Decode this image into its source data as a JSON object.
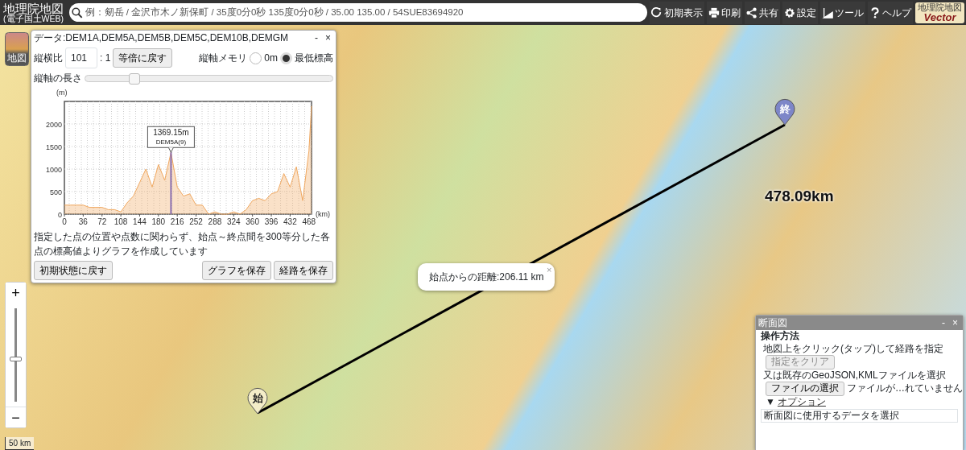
{
  "header": {
    "logo_lines": [
      "地理院地図",
      "(電子国土WEB)"
    ],
    "search": {
      "placeholder": "例：剱岳 / 金沢市木ノ新保町 / 35度0分0秒 135度0分0秒 / 35.00 135.00 / 54SUE83694920"
    },
    "toolbar": [
      {
        "kind": "reload",
        "label": "初期表示"
      },
      {
        "kind": "print",
        "label": "印刷"
      },
      {
        "kind": "share",
        "label": "共有"
      },
      {
        "kind": "settings",
        "label": "設定"
      },
      {
        "kind": "tool",
        "label": "ツール"
      },
      {
        "kind": "help",
        "label": "ヘルプ"
      }
    ],
    "vector_badge": [
      "地理院地図",
      "Vector"
    ]
  },
  "map": {
    "layer_button": "地図",
    "start_marker": "始",
    "end_marker": "終",
    "distance_label": "478.09km",
    "popup": {
      "text": "始点からの距離:206.11 km",
      "close": "×"
    },
    "zoom_in": "+",
    "zoom_out": "−",
    "zoom_slider": {
      "level": 0.46
    },
    "scale": "50 km"
  },
  "profile_window": {
    "data_label": "データ:DEM1A,DEM5A,DEM5B,DEM5C,DEM10B,DEMGM",
    "minimize": "-",
    "close": "×",
    "ratio_label": "縦横比",
    "ratio_value": "101",
    "ratio_suffix": ": 1",
    "reset_ratio": "等倍に戻す",
    "axis_memory_label": "縦軸メモリ",
    "radios": [
      {
        "label": "0m",
        "selected": false
      },
      {
        "label": "最低標高",
        "selected": true
      }
    ],
    "axis_length_label": "縦軸の長さ",
    "axis_length": {
      "level": 0.2
    },
    "chart_data": {
      "type": "area",
      "xlabel": "(km)",
      "ylabel": "(m)",
      "xlim": [
        0,
        473
      ],
      "ylim": [
        0,
        2500
      ],
      "xticks": [
        0,
        36,
        72,
        108,
        144,
        180,
        216,
        252,
        288,
        324,
        360,
        396,
        432,
        468
      ],
      "yticks": [
        0,
        500,
        1000,
        1500,
        2000
      ],
      "x": [
        0,
        12,
        24,
        36,
        48,
        60,
        72,
        84,
        96,
        108,
        120,
        132,
        144,
        156,
        168,
        180,
        192,
        204,
        216,
        228,
        240,
        252,
        264,
        276,
        288,
        300,
        312,
        324,
        336,
        348,
        360,
        372,
        384,
        396,
        408,
        420,
        432,
        444,
        456,
        468,
        473
      ],
      "grid": true,
      "series": [
        {
          "color": "#f0a860",
          "values": [
            200,
            200,
            200,
            200,
            150,
            150,
            150,
            100,
            100,
            50,
            250,
            400,
            700,
            1000,
            600,
            1100,
            750,
            1370,
            600,
            400,
            450,
            200,
            200,
            0,
            50,
            0,
            0,
            50,
            0,
            100,
            300,
            350,
            300,
            450,
            500,
            900,
            600,
            1050,
            300,
            1400,
            2400
          ]
        }
      ],
      "annotations": [
        {
          "text": "1369.15m"
        },
        {
          "text": "DEM5A(9)"
        }
      ]
    },
    "note": "指定した点の位置や点数に関わらず、始点～終点間を300等分した各点の標高値よりグラフを作成しています",
    "buttons": [
      "初期状態に戻す",
      "グラフを保存",
      "経路を保存"
    ]
  },
  "section_window": {
    "title": "断面図",
    "minimize": "-",
    "close": "×",
    "heading": "操作方法",
    "instruction_1": "地図上をクリック(タップ)して経路を指定",
    "clear_button": {
      "label": "指定をクリア",
      "disabled": true
    },
    "instruction_2": "又は既存のGeoJSON,KMLファイルを選択",
    "file_button": "ファイルの選択",
    "file_status": "ファイルが…れていません",
    "options_toggle": "▼",
    "options_label": "オプション",
    "data_select_label": "断面図に使用するデータを選択"
  }
}
